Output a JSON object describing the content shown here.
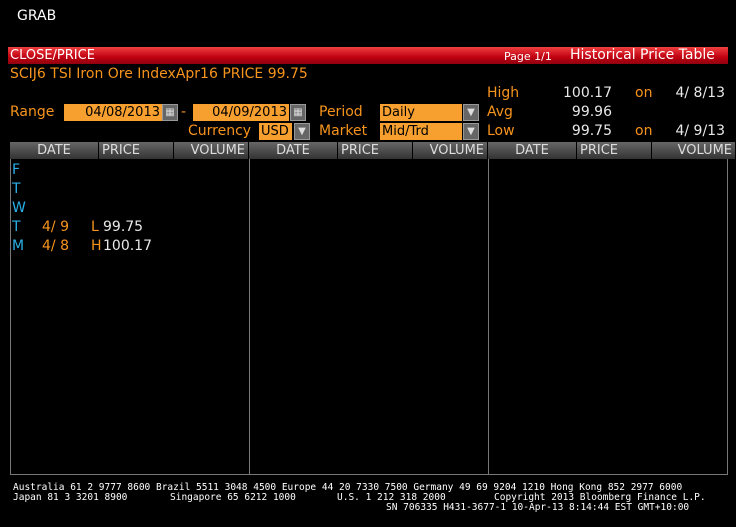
{
  "app_title": "GRAB",
  "header": {
    "function": "CLOSE/PRICE",
    "page": "Page 1/1",
    "title": "Historical Price Table"
  },
  "security_line": "SCIJ6 TSI Iron Ore IndexApr16 PRICE 99.75",
  "controls": {
    "range_label": "Range",
    "start_date": "04/08/2013",
    "dash": "-",
    "end_date": "04/09/2013",
    "period_label": "Period",
    "period_value": "Daily",
    "currency_label": "Currency",
    "currency_value": "USD",
    "market_label": "Market",
    "market_value": "Mid/Trd"
  },
  "stats": {
    "high_label": "High",
    "high_value": "100.17",
    "high_on": "on",
    "high_date": "4/ 8/13",
    "avg_label": "Avg",
    "avg_value": "99.96",
    "low_label": "Low",
    "low_value": "99.75",
    "low_on": "on",
    "low_date": "4/ 9/13"
  },
  "columns": {
    "date": "DATE",
    "price": "PRICE",
    "volume": "VOLUME"
  },
  "rows": [
    {
      "day": "F",
      "date": "",
      "flag": "",
      "price": ""
    },
    {
      "day": "T",
      "date": "",
      "flag": "",
      "price": ""
    },
    {
      "day": "W",
      "date": "",
      "flag": "",
      "price": ""
    },
    {
      "day": "T",
      "date": "4/ 9",
      "flag": "L",
      "price": "99.75"
    },
    {
      "day": "M",
      "date": "4/ 8",
      "flag": "H",
      "price": "100.17"
    }
  ],
  "footer": {
    "line1": "Australia 61 2 9777 8600 Brazil 5511 3048 4500 Europe 44 20 7330 7500 Germany 49 69 9204 1210 Hong Kong 852 2977 6000",
    "line2_a": "Japan 81 3 3201 8900",
    "line2_b": "Singapore 65 6212 1000",
    "line2_c": "U.S. 1 212 318 2000",
    "line2_d": "Copyright 2013 Bloomberg Finance L.P.",
    "line3": "SN 706335 H431-3677-1 10-Apr-13  8:14:44 EST  GMT+10:00"
  }
}
